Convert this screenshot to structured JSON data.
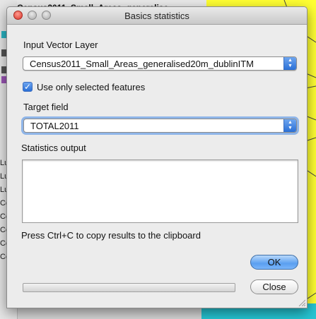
{
  "background": {
    "layer_title": "Census2011_Small_Areas_generalise",
    "layer_items": [
      "Lu",
      "Lu",
      "Lu",
      "Ce",
      "Ce",
      "Ce",
      "Ce",
      "Ce"
    ]
  },
  "dialog": {
    "title": "Basics statistics",
    "input_layer_label": "Input Vector Layer",
    "input_layer_value": "Census2011_Small_Areas_generalised20m_dublinITM",
    "use_selected_label": "Use only selected features",
    "use_selected_checked": true,
    "target_field_label": "Target field",
    "target_field_value": "TOTAL2011",
    "stats_output_label": "Statistics output",
    "stats_output_value": "",
    "hint": "Press Ctrl+C to copy results to the clipboard",
    "ok_label": "OK",
    "close_label": "Close",
    "progress": 0
  },
  "colors": {
    "accent": "#2a6fd6",
    "map_fill": "#ffff33",
    "map_water": "#26c6d4"
  }
}
